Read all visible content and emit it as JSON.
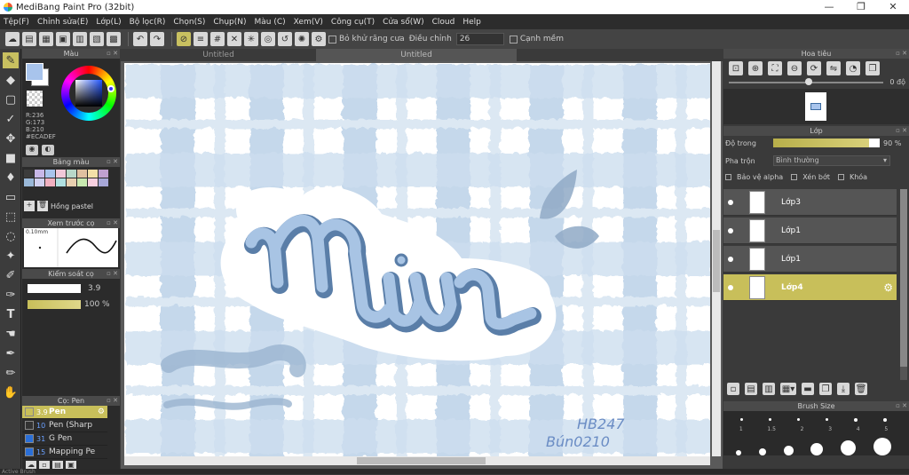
{
  "app": {
    "title": "MediBang Paint Pro (32bit)",
    "window_buttons": [
      "—",
      "❐",
      "✕"
    ]
  },
  "menu": [
    "Tệp(F)",
    "Chỉnh sửa(E)",
    "Lớp(L)",
    "Bộ lọc(R)",
    "Chọn(S)",
    "Chụp(N)",
    "Màu (C)",
    "Xem(V)",
    "Công cụ(T)",
    "Cửa sổ(W)",
    "Cloud",
    "Help"
  ],
  "toolbar": {
    "antialias_label": "Bỏ khử răng cưa",
    "adjust_label": "Điều chỉnh",
    "adjust_value": "26",
    "snap_label": "Cạnh mềm"
  },
  "color_panel": {
    "title": "Màu",
    "r": "R:236",
    "g": "G:173",
    "b": "B:210",
    "hex": "#ECADEF"
  },
  "palette_panel": {
    "title": "Bảng màu",
    "name": "Hồng pastel",
    "colors": [
      "#3c3c3c",
      "#c8b8e8",
      "#a8c4ec",
      "#f0c8d8",
      "#b8d8c8",
      "#e0c0a0",
      "#f4e0a8",
      "#c0a0d0",
      "#9ab8d8",
      "#d0d0f0",
      "#f0b0c0",
      "#b0e0e0",
      "#e8d0b0",
      "#c8e8b0",
      "#f8d0e0",
      "#a8a8d8"
    ]
  },
  "preview_panel": {
    "title": "Xem trước cọ",
    "size_label": "0.10mm"
  },
  "brush_control": {
    "title": "Kiểm soát cọ",
    "size_value": "3.9",
    "opacity_value": "100 %"
  },
  "brush_panel": {
    "title": "Cọ: Pen",
    "items": [
      {
        "size": "3.9",
        "name": "Pen",
        "color": "#c8bf5a",
        "selected": true
      },
      {
        "size": "10",
        "name": "Pen (Sharp",
        "color": "#333333",
        "selected": false
      },
      {
        "size": "31",
        "name": "G Pen",
        "color": "#2a6fd8",
        "selected": false
      },
      {
        "size": "15",
        "name": "Mapping Pe",
        "color": "#2a6fd8",
        "selected": false
      }
    ]
  },
  "canvas": {
    "tabs": [
      "Untitled",
      "Untitled"
    ],
    "signature_line1": "HB247",
    "signature_line2": "Bún0210"
  },
  "navigator": {
    "title": "Hoa tiêu",
    "rotation": "0 độ"
  },
  "layer_panel": {
    "title": "Lớp",
    "opacity_label": "Độ trong",
    "opacity_value": "90 %",
    "opacity_fraction": 0.9,
    "blend_label": "Pha trộn",
    "blend_value": "Bình thường",
    "protect_alpha": "Bảo vệ alpha",
    "clipping": "Xén bớt",
    "lock": "Khóa",
    "layers": [
      {
        "name": "Lớp3",
        "selected": false
      },
      {
        "name": "Lớp1",
        "selected": false
      },
      {
        "name": "Lớp1",
        "selected": false
      },
      {
        "name": "Lớp4",
        "selected": true
      }
    ]
  },
  "brush_size_panel": {
    "title": "Brush Size",
    "sizes": [
      "1",
      "1.5",
      "2",
      "3",
      "4",
      "5"
    ]
  },
  "statusbar": {
    "text": "Active Brush"
  }
}
